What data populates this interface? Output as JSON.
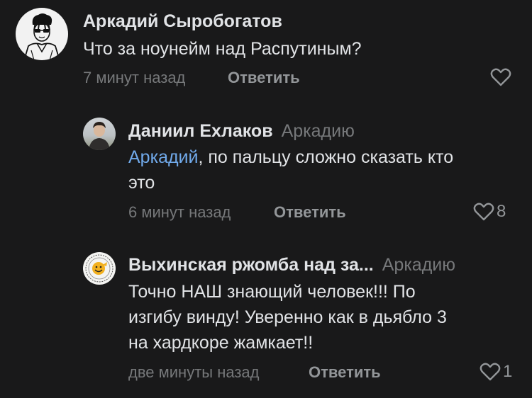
{
  "comments": [
    {
      "author": "Аркадий Сыробогатов",
      "reply_to": "",
      "mention": "",
      "text_lines": [
        "Что за ноунейм над Распутиным?"
      ],
      "time": "7 минут назад",
      "reply_label": "Ответить",
      "likes": ""
    },
    {
      "author": "Даниил Ехлаков",
      "reply_to": "Аркадию",
      "mention": "Аркадий",
      "text_lines": [
        ", по пальцу сложно сказать кто",
        "это"
      ],
      "time": "6 минут назад",
      "reply_label": "Ответить",
      "likes": "8"
    },
    {
      "author": "Выхинская ржомба над за...",
      "reply_to": "Аркадию",
      "mention": "",
      "text_lines": [
        "Точно НАШ знающий человек!!! По",
        "изгибу винду! Уверенно как в дьябло 3",
        "на хардкоре жамкает!!"
      ],
      "time": "две минуты назад",
      "reply_label": "Ответить",
      "likes": "1"
    }
  ],
  "colors": {
    "background": "#19191a",
    "text": "#e1e3e6",
    "secondary": "#76787a",
    "mention": "#71aaeb"
  },
  "icons": [
    "heart-outline-icon"
  ]
}
